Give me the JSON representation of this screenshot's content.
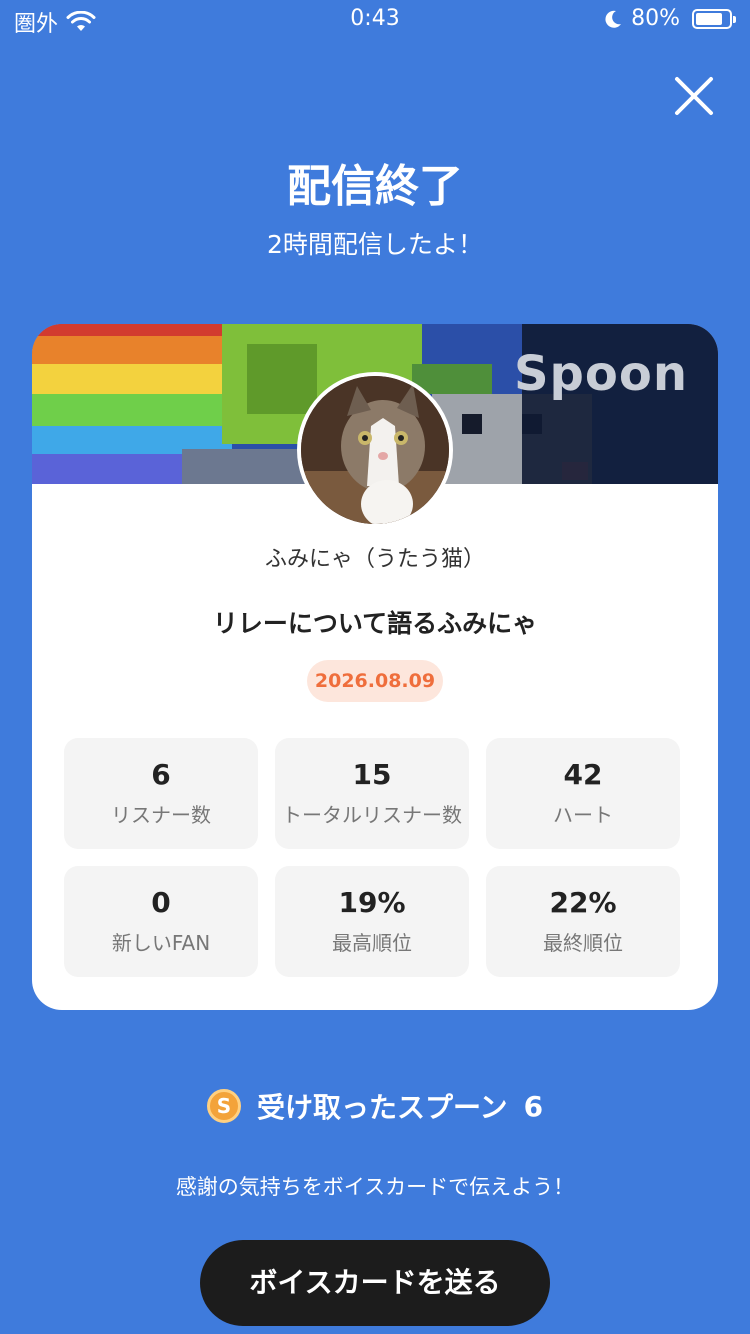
{
  "status_bar": {
    "carrier": "圏外",
    "time": "0:43",
    "battery": "80%",
    "battery_level": 0.8,
    "icons": [
      "wifi-icon",
      "moon-icon",
      "battery-icon"
    ]
  },
  "header": {
    "close_icon": "close-icon",
    "title": "配信終了",
    "subtitle": "2時間配信したよ！"
  },
  "card": {
    "banner_logo": "Spoon",
    "username": "ふみにゃ（うたう猫）",
    "live_title": "リレーについて語るふみにゃ",
    "date": "2026.08.09",
    "stats": [
      {
        "value": "6",
        "label": "リスナー数"
      },
      {
        "value": "15",
        "label": "トータルリスナー数"
      },
      {
        "value": "42",
        "label": "ハート"
      },
      {
        "value": "0",
        "label": "新しいFAN"
      },
      {
        "value": "19%",
        "label": "最高順位"
      },
      {
        "value": "22%",
        "label": "最終順位"
      }
    ]
  },
  "spoons": {
    "coin_glyph": "S",
    "label": "受け取ったスプーン",
    "count": "6"
  },
  "thanks_text": "感謝の気持ちをボイスカードで伝えよう！",
  "voice_card_button": "ボイスカードを送る",
  "colors": {
    "background": "#3f7bdc",
    "date_badge_text": "#ef6e3c",
    "button": "#1c1c1c"
  }
}
